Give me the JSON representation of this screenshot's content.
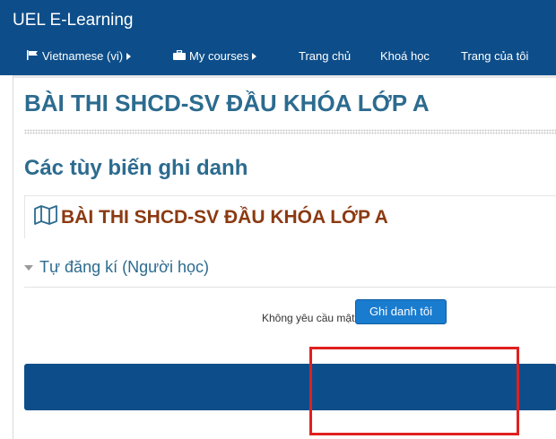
{
  "header": {
    "brand": "UEL E-Learning",
    "nav": [
      {
        "label": "Vietnamese (vi)",
        "icon": "flag-icon",
        "has_caret": true
      },
      {
        "label": "My courses",
        "icon": "briefcase-icon",
        "has_caret": true
      },
      {
        "label": "Trang chủ"
      },
      {
        "label": "Khoá học"
      },
      {
        "label": "Trang của tôi"
      }
    ]
  },
  "main": {
    "course_title": "BÀI THI SHCD-SV ĐẦU KHÓA LỚP A",
    "page_heading": "Các tùy biến ghi danh",
    "course_box": {
      "icon": "map-icon",
      "name": "BÀI THI SHCD-SV ĐẦU KHÓA LỚP A"
    },
    "enrol_section": {
      "title": "Tự đăng kí (Người học)",
      "info": "Không yêu cầu mật khẩu đăng kí",
      "button_label": "Ghi danh tôi"
    }
  },
  "colors": {
    "header_bg": "#0d4e8a",
    "title": "#2c6b8f",
    "course_name": "#8b3a12",
    "button": "#1a7ccf",
    "highlight": "#e02020"
  }
}
